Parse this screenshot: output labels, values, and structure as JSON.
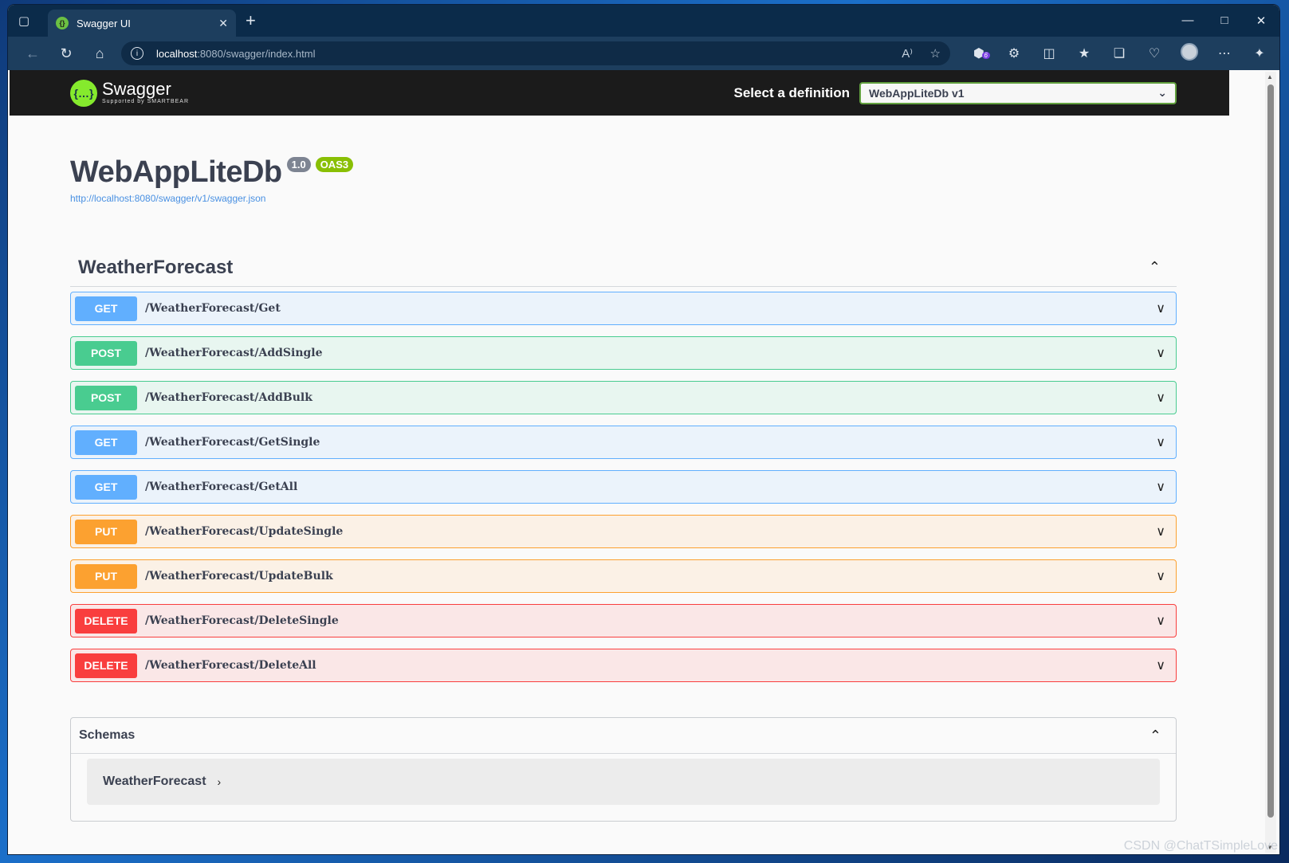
{
  "browser": {
    "tab_title": "Swagger UI",
    "url_host": "localhost",
    "url_rest": ":8080/swagger/index.html",
    "extension_badge": "6"
  },
  "swagger": {
    "logo_name": "Swagger",
    "logo_sub": "Supported by SMARTBEAR",
    "select_label": "Select a definition",
    "selected_definition": "WebAppLiteDb v1"
  },
  "info": {
    "title": "WebAppLiteDb",
    "version": "1.0",
    "oas": "OAS3",
    "spec_url": "http://localhost:8080/swagger/v1/swagger.json"
  },
  "tag": {
    "name": "WeatherForecast",
    "operations": [
      {
        "method": "GET",
        "path": "/WeatherForecast/Get",
        "cls": "get"
      },
      {
        "method": "POST",
        "path": "/WeatherForecast/AddSingle",
        "cls": "post"
      },
      {
        "method": "POST",
        "path": "/WeatherForecast/AddBulk",
        "cls": "post"
      },
      {
        "method": "GET",
        "path": "/WeatherForecast/GetSingle",
        "cls": "get"
      },
      {
        "method": "GET",
        "path": "/WeatherForecast/GetAll",
        "cls": "get"
      },
      {
        "method": "PUT",
        "path": "/WeatherForecast/UpdateSingle",
        "cls": "put"
      },
      {
        "method": "PUT",
        "path": "/WeatherForecast/UpdateBulk",
        "cls": "put"
      },
      {
        "method": "DELETE",
        "path": "/WeatherForecast/DeleteSingle",
        "cls": "delete"
      },
      {
        "method": "DELETE",
        "path": "/WeatherForecast/DeleteAll",
        "cls": "delete"
      }
    ]
  },
  "schemas": {
    "title": "Schemas",
    "items": [
      "WeatherForecast"
    ]
  },
  "watermark": "CSDN @ChatTSimpleLove",
  "colors": {
    "get": "#61affe",
    "post": "#49cc90",
    "put": "#fca130",
    "delete": "#f93e3e",
    "swagger_green": "#85ea2d"
  }
}
